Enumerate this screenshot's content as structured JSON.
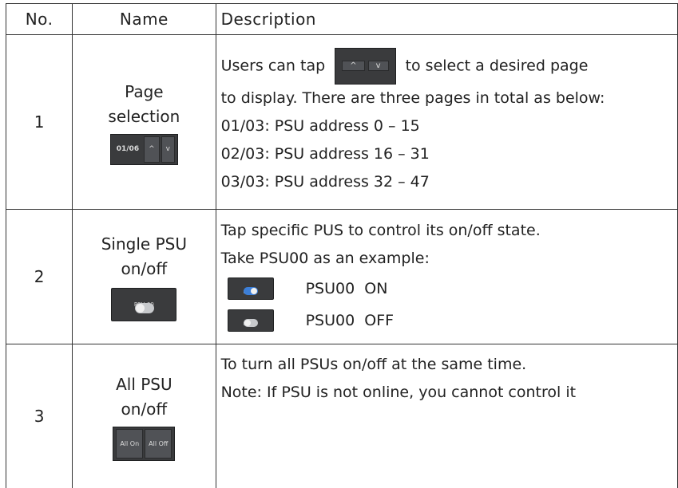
{
  "headers": {
    "no": "No.",
    "name": "Name",
    "description": "Description"
  },
  "rows": [
    {
      "no": "1",
      "name_line1": "Page",
      "name_line2": "selection",
      "widget": {
        "page_value": "01/06",
        "up": "^",
        "down": "v"
      },
      "desc_pre": "Users can tap",
      "desc_post": "to select a desired page",
      "desc_lines": [
        "to display. There are three pages in total as below:",
        "01/03: PSU address 0 – 15",
        "02/03: PSU address 16 – 31",
        "03/03: PSU address 32 – 47"
      ]
    },
    {
      "no": "2",
      "name_line1": "Single PSU",
      "name_line2": "on/off",
      "widget": {
        "label": "PSU 00"
      },
      "desc_lines": [
        "Tap specific PUS to control its on/off state.",
        "Take PSU00 as an example:"
      ],
      "on_text": "PSU00  ON",
      "off_text": "PSU00  OFF"
    },
    {
      "no": "3",
      "name_line1": "All PSU",
      "name_line2": "on/off",
      "widget": {
        "all_on": "All On",
        "all_off": "All Off"
      },
      "desc_lines": [
        "To turn all PSUs on/off at the same time.",
        "Note: If PSU is not online, you cannot control it"
      ]
    }
  ],
  "colors": {
    "widget_bg": "#3a3b3d",
    "toggle_on": "#3c7fd8",
    "border": "#333333"
  }
}
